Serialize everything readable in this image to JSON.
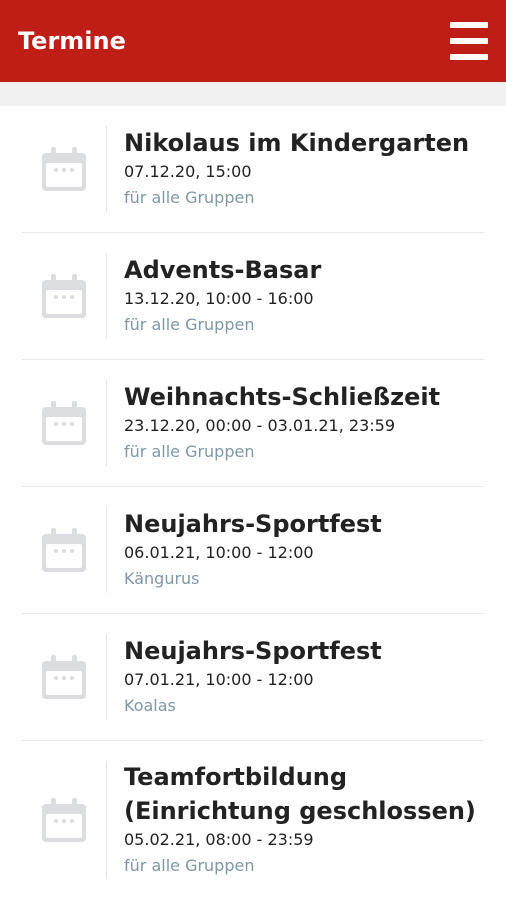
{
  "header": {
    "title": "Termine",
    "menu_icon": "hamburger-menu-icon"
  },
  "events": [
    {
      "title": "Nikolaus im Kindergarten",
      "date": "07.12.20, 15:00",
      "group": "für alle Gruppen"
    },
    {
      "title": "Advents-Basar",
      "date": "13.12.20, 10:00 - 16:00",
      "group": "für alle Gruppen"
    },
    {
      "title": "Weihnachts-Schließzeit",
      "date": "23.12.20, 00:00 - 03.01.21, 23:59",
      "group": "für alle Gruppen"
    },
    {
      "title": "Neujahrs-Sportfest",
      "date": "06.01.21, 10:00 - 12:00",
      "group": "Kängurus"
    },
    {
      "title": "Neujahrs-Sportfest",
      "date": "07.01.21, 10:00 - 12:00",
      "group": "Koalas"
    },
    {
      "title": "Teamfortbildung (Einrichtung geschlossen)",
      "date": "05.02.21, 08:00 - 23:59",
      "group": "für alle Gruppen"
    }
  ],
  "colors": {
    "accent": "#be1e15",
    "group_text": "#7f98a6",
    "icon": "#dcdde0"
  }
}
